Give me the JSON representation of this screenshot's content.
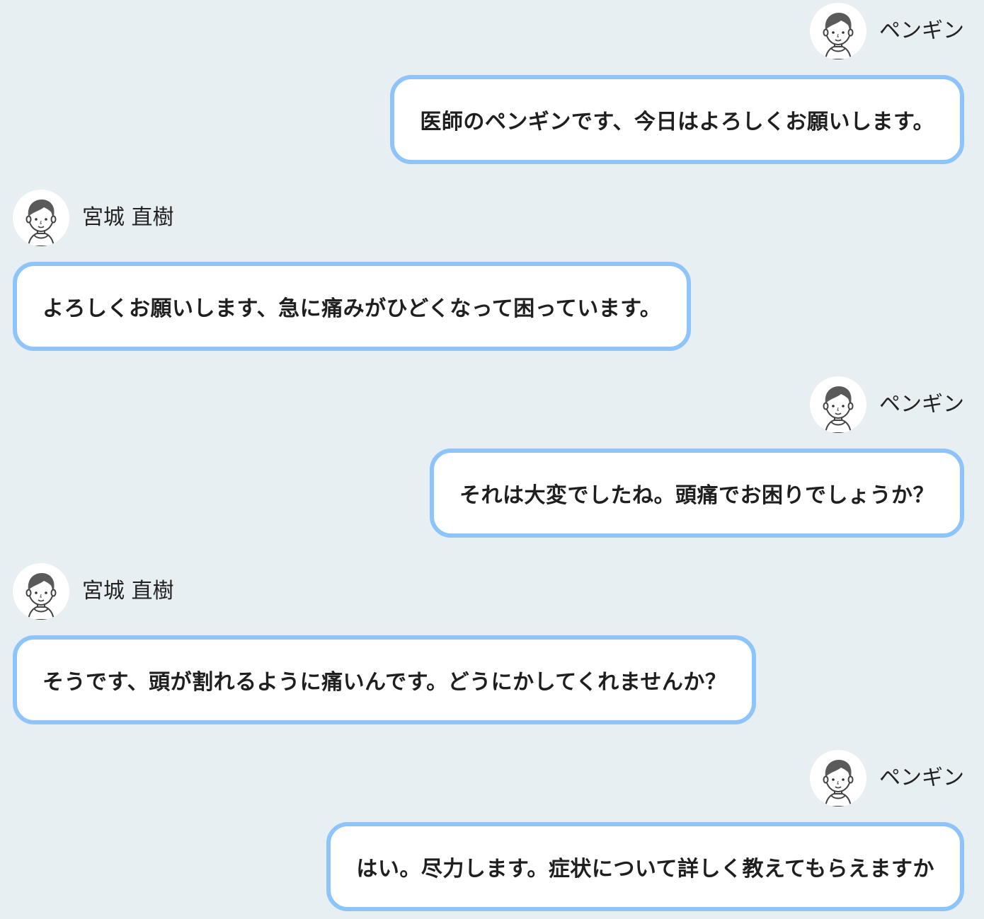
{
  "messages": [
    {
      "side": "right",
      "speaker": "ペンギン",
      "text": "医師のペンギンです、今日はよろしくお願いします。"
    },
    {
      "side": "left",
      "speaker": "宮城 直樹",
      "text": "よろしくお願いします、急に痛みがひどくなって困っています。"
    },
    {
      "side": "right",
      "speaker": "ペンギン",
      "text": "それは大変でしたね。頭痛でお困りでしょうか？"
    },
    {
      "side": "left",
      "speaker": "宮城 直樹",
      "text": "そうです、頭が割れるように痛いんです。どうにかしてくれませんか？"
    },
    {
      "side": "right",
      "speaker": "ペンギン",
      "text": "はい。尽力します。症状について詳しく教えてもらえますか"
    }
  ],
  "colors": {
    "background": "#e8eff2",
    "bubble_border": "#8cc4fb",
    "bubble_fill": "#ffffff"
  },
  "icons": {
    "avatar": "person-avatar-icon"
  }
}
